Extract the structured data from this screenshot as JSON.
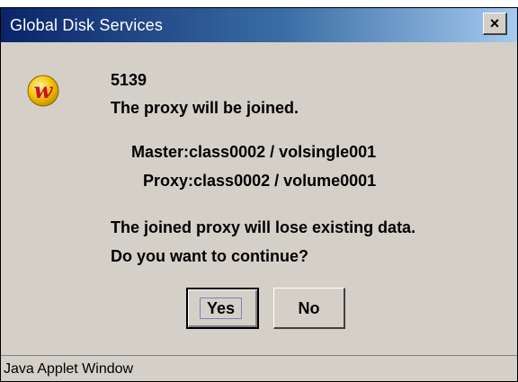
{
  "window": {
    "title": "Global Disk Services",
    "close_glyph": "×",
    "icon": "app-logo-icon"
  },
  "message": {
    "code": "5139",
    "line1": "The proxy will be joined.",
    "master": "Master:class0002 / volsingle001",
    "proxy": "Proxy:class0002 / volume0001",
    "warning": "The joined proxy will lose existing data.",
    "question": "Do you want to continue?"
  },
  "buttons": {
    "yes_label": "Yes",
    "no_label": "No"
  },
  "statusbar": {
    "text": "Java Applet Window"
  },
  "colors": {
    "title_gradient_start": "#0a246a",
    "title_gradient_end": "#a6caf0",
    "dialog_bg": "#d4d0c8",
    "icon_yellow": "#f3c400",
    "icon_red": "#c8102e"
  }
}
